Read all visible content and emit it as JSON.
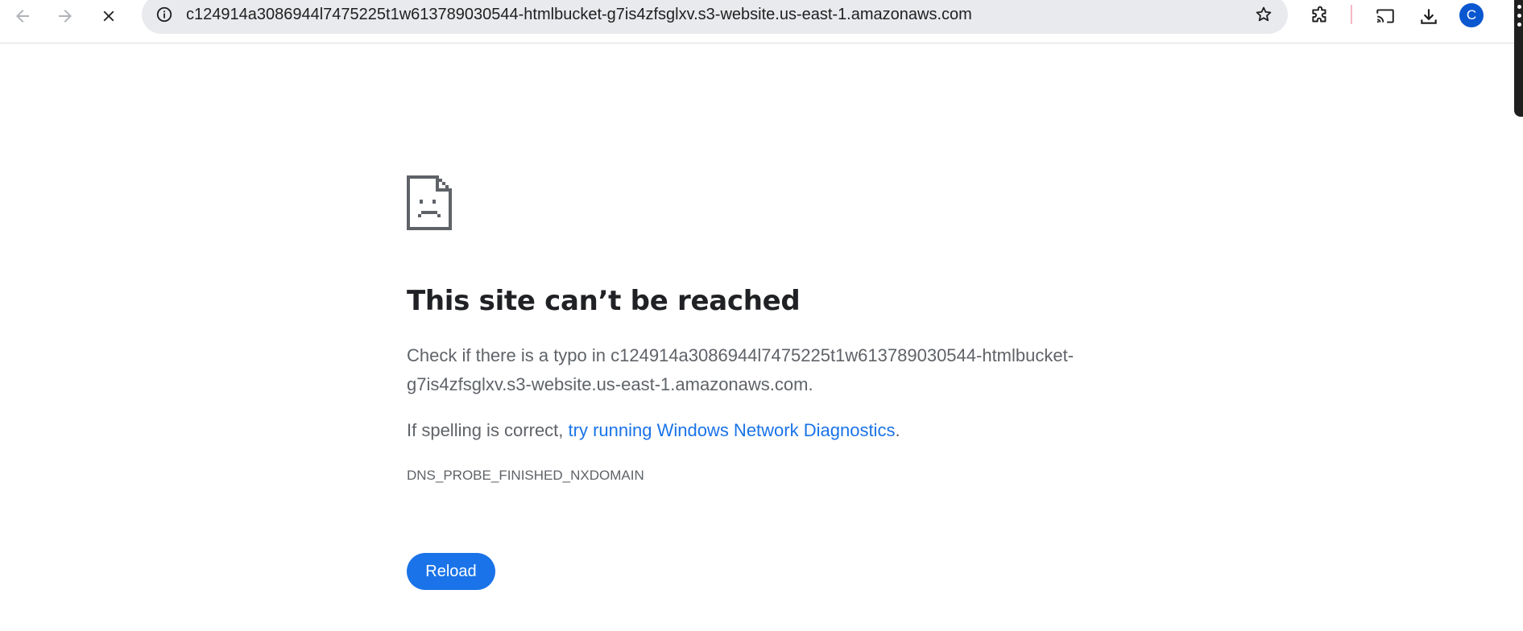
{
  "toolbar": {
    "back_icon": "arrow-left-icon",
    "forward_icon": "arrow-right-icon",
    "stop_icon": "close-icon",
    "url": "c124914a3086944l7475225t1w613789030544-htmlbucket-g7is4zfsglxv.s3-website.us-east-1.amazonaws.com",
    "site_info_icon": "info-icon",
    "bookmark_icon": "star-icon",
    "extensions_icon": "puzzle-icon",
    "cast_icon": "cast-icon",
    "downloads_icon": "download-icon",
    "profile_initial": "C"
  },
  "error": {
    "icon": "sad-document-icon",
    "title": "This site can’t be reached",
    "desc_line1": "Check if there is a typo in c124914a3086944l7475225t1w613789030544-htmlbucket-",
    "desc_line2": "g7is4zfsglxv.s3-website.us-east-1.amazonaws.com.",
    "suggestion_prefix": "If spelling is correct, ",
    "suggestion_link": "try running Windows Network Diagnostics",
    "suggestion_suffix": ".",
    "code": "DNS_PROBE_FINISHED_NXDOMAIN",
    "reload_label": "Reload"
  },
  "colors": {
    "accent": "#1a73e8",
    "avatar": "#0b57d0",
    "omnibox": "#e8eaed",
    "secondary_text": "#5f6368"
  }
}
